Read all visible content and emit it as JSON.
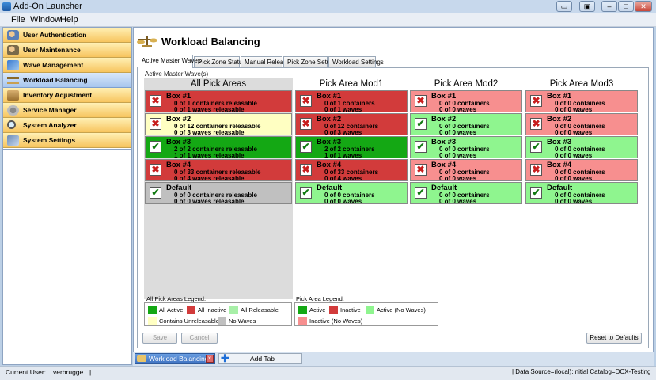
{
  "window": {
    "title": "Add-On Launcher"
  },
  "menu": [
    "File",
    "Window",
    "Help"
  ],
  "sidebar": {
    "items": [
      {
        "label": "User Authentication",
        "icon": "user-auth-icon"
      },
      {
        "label": "User Maintenance",
        "icon": "user-maintenance-icon"
      },
      {
        "label": "Wave Management",
        "icon": "wave-management-icon"
      },
      {
        "label": "Workload Balancing",
        "icon": "scale-icon"
      },
      {
        "label": "Inventory Adjustment",
        "icon": "inventory-icon"
      },
      {
        "label": "Service Manager",
        "icon": "service-icon"
      },
      {
        "label": "System Analyzer",
        "icon": "magnifier-icon"
      },
      {
        "label": "System Settings",
        "icon": "settings-icon"
      }
    ],
    "active_index": 3
  },
  "page": {
    "title": "Workload Balancing"
  },
  "tabs": [
    "Active Master Waves",
    "Pick Zone Status",
    "Manual Release",
    "Pick Zone Setup",
    "Workload Settings"
  ],
  "group_label": "Active Master Wave(s)",
  "columns": [
    {
      "title": "All Pick Areas",
      "boxes": [
        {
          "name": "Box #1",
          "line1": "0 of 1 containers releasable",
          "line2": "0 of 1 waves releasable",
          "state": "inactive"
        },
        {
          "name": "Box #2",
          "line1": "0 of 12 containers releasable",
          "line2": "0 of 3 waves releasable",
          "state": "unreleasable"
        },
        {
          "name": "Box #3",
          "line1": "2 of 2 containers releasable",
          "line2": "1 of 1 waves releasable",
          "state": "active"
        },
        {
          "name": "Box #4",
          "line1": "0 of 33 containers releasable",
          "line2": "0 of 4 waves releasable",
          "state": "inactive"
        },
        {
          "name": "Default",
          "line1": "0 of 0 containers releasable",
          "line2": "0 of 0 waves releasable",
          "state": "nowaves"
        }
      ]
    },
    {
      "title": "Pick Area Mod1",
      "boxes": [
        {
          "name": "Box #1",
          "line1": "0 of 1 containers",
          "line2": "0 of 1 waves",
          "state": "inactive"
        },
        {
          "name": "Box #2",
          "line1": "0 of 12 containers",
          "line2": "0 of 3 waves",
          "state": "inactive"
        },
        {
          "name": "Box #3",
          "line1": "2 of 2 containers",
          "line2": "1 of 1 waves",
          "state": "active"
        },
        {
          "name": "Box #4",
          "line1": "0 of 33 containers",
          "line2": "0 of 4 waves",
          "state": "inactive"
        },
        {
          "name": "Default",
          "line1": "0 of 0 containers",
          "line2": "0 of 0 waves",
          "state": "active_nowaves"
        }
      ]
    },
    {
      "title": "Pick Area Mod2",
      "boxes": [
        {
          "name": "Box #1",
          "line1": "0 of 0 containers",
          "line2": "0 of 0 waves",
          "state": "inactive_nowaves"
        },
        {
          "name": "Box #2",
          "line1": "0 of 0 containers",
          "line2": "0 of 0 waves",
          "state": "active_nowaves"
        },
        {
          "name": "Box #3",
          "line1": "0 of 0 containers",
          "line2": "0 of 0 waves",
          "state": "active_nowaves"
        },
        {
          "name": "Box #4",
          "line1": "0 of 0 containers",
          "line2": "0 of 0 waves",
          "state": "inactive_nowaves"
        },
        {
          "name": "Default",
          "line1": "0 of 0 containers",
          "line2": "0 of 0 waves",
          "state": "active_nowaves"
        }
      ]
    },
    {
      "title": "Pick Area Mod3",
      "boxes": [
        {
          "name": "Box #1",
          "line1": "0 of 0 containers",
          "line2": "0 of 0 waves",
          "state": "inactive_nowaves"
        },
        {
          "name": "Box #2",
          "line1": "0 of 0 containers",
          "line2": "0 of 0 waves",
          "state": "inactive_nowaves"
        },
        {
          "name": "Box #3",
          "line1": "0 of 0 containers",
          "line2": "0 of 0 waves",
          "state": "active_nowaves"
        },
        {
          "name": "Box #4",
          "line1": "0 of 0 containers",
          "line2": "0 of 0 waves",
          "state": "inactive_nowaves"
        },
        {
          "name": "Default",
          "line1": "0 of 0 containers",
          "line2": "0 of 0 waves",
          "state": "active_nowaves"
        }
      ]
    }
  ],
  "legend_all": {
    "title": "All Pick Areas Legend:",
    "items": [
      "All Active",
      "All Inactive",
      "All Releasable",
      "Contains Unreleasable",
      "No Waves"
    ]
  },
  "legend_pick": {
    "title": "Pick Area Legend:",
    "items": [
      "Active",
      "Inactive",
      "Active (No Waves)",
      "Inactive (No Waves)"
    ]
  },
  "colors": {
    "active": "#14a814",
    "inactive": "#d23b3b",
    "active_nowaves": "#8ff58f",
    "inactive_nowaves": "#f78f8f",
    "unreleasable": "#ffffc2",
    "nowaves": "#c0c0c0",
    "releasable": "#a8f0a8"
  },
  "buttons": {
    "save": "Save",
    "cancel": "Cancel",
    "reset": "Reset to Defaults"
  },
  "bottom_tabs": {
    "active_label": "Workload Balancing",
    "add_label": "Add Tab"
  },
  "status": {
    "user_label": "Current User:",
    "user": "verbrugge",
    "sep": "|",
    "datasource": "| Data Source=(local);Initial Catalog=DCX-Testing"
  }
}
